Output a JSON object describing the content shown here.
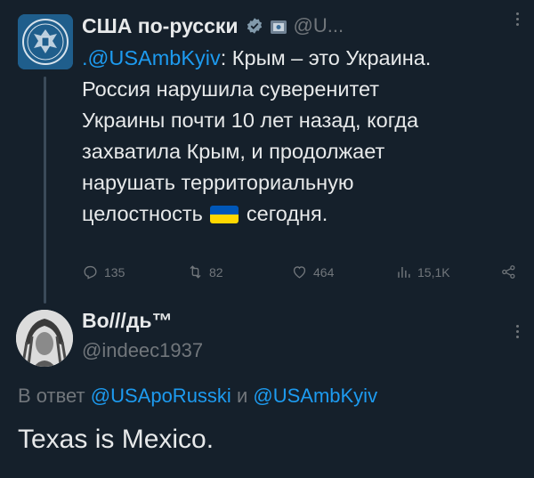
{
  "tweet1": {
    "author_name": "США по-русски",
    "author_handle": "@U...",
    "text_mention": ".@USAmbKyiv",
    "text_after_mention": ": Крым – это Украина.",
    "text_line2": "Россия нарушила суверенитет",
    "text_line3": "Украины почти 10 лет назад, когда",
    "text_line4": "захватила Крым, и продолжает",
    "text_line5": "нарушать территориальную",
    "text_line6_before_flag": "целостность",
    "text_line6_after_flag": "сегодня.",
    "stats": {
      "replies": "135",
      "reposts": "82",
      "likes": "464",
      "views": "15,1K"
    },
    "icons": [
      "verified-icon",
      "flag-badge-icon",
      "ukraine-flag-emoji",
      "reply-icon",
      "repost-icon",
      "like-icon",
      "views-icon",
      "share-icon",
      "more-icon"
    ],
    "colors": {
      "ua_blue": "#0057b8",
      "ua_yellow": "#ffd700",
      "verified": "#829aab"
    }
  },
  "tweet2": {
    "author_name": "Во///дь™",
    "author_handle": "@indeec1937",
    "reply_prefix": "В ответ",
    "reply_mention1": "@USApoRusski",
    "reply_and": "и",
    "reply_mention2": "@USAmbKyiv",
    "text": "Texas is Mexico."
  },
  "theme": {
    "background": "#15202b",
    "text": "#e7e9ea",
    "muted": "#71767b",
    "link": "#1d9bf0"
  }
}
